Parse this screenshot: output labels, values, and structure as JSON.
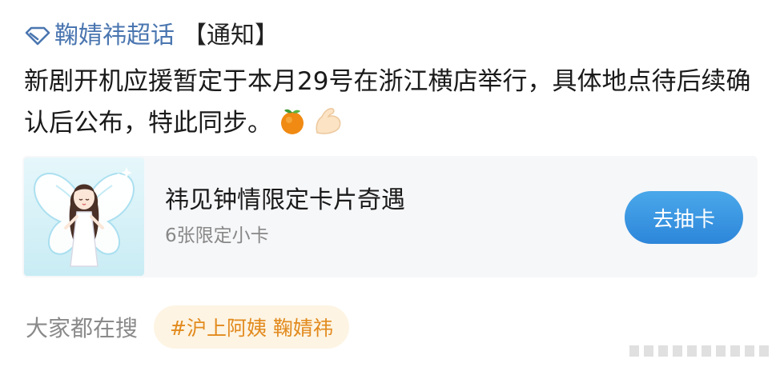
{
  "topic": {
    "name": "鞠婧祎超话",
    "tag": "【通知】"
  },
  "post": {
    "text": "新剧开机应援暂定于本月29号在浙江横店举行，具体地点待后续确认后公布，特此同步。"
  },
  "card": {
    "title": "祎见钟情限定卡片奇遇",
    "subtitle": "6张限定小卡",
    "button_label": "去抽卡"
  },
  "search": {
    "label": "大家都在搜",
    "hot_topic": "#沪上阿姨 鞠婧祎"
  },
  "colors": {
    "topic_link": "#4a76b0",
    "button": "#3497e2",
    "hot_topic_text": "#e28a1d",
    "hot_topic_bg": "#fdf4e3"
  }
}
